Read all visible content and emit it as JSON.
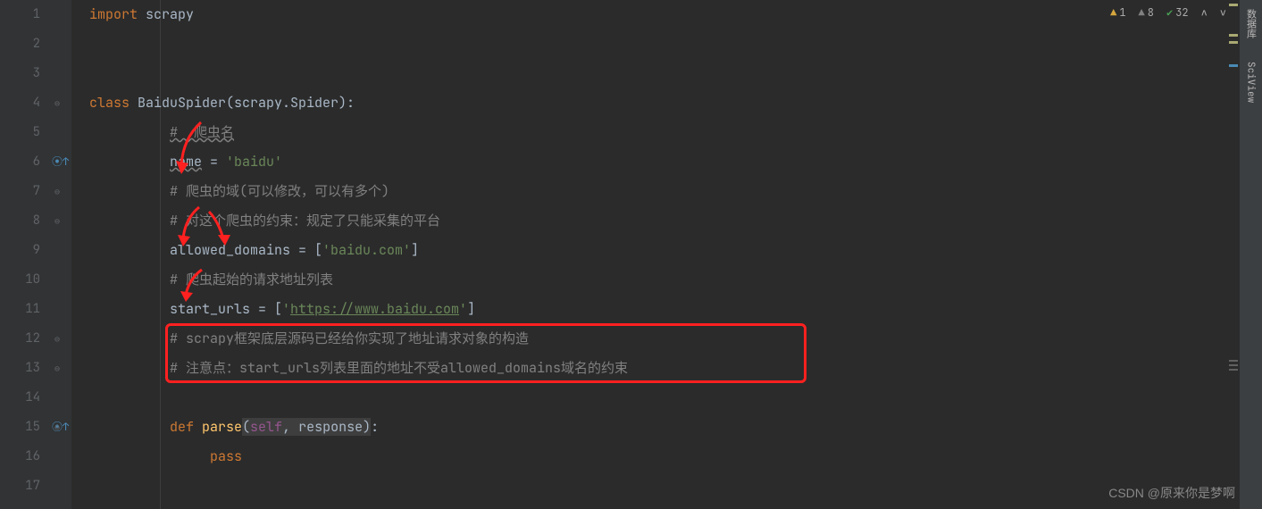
{
  "gutter": {
    "lines": [
      "1",
      "2",
      "3",
      "4",
      "5",
      "6",
      "7",
      "8",
      "9",
      "10",
      "11",
      "12",
      "13",
      "14",
      "15",
      "16",
      "17"
    ]
  },
  "code": {
    "l1_import": "import",
    "l1_scrapy": " scrapy",
    "l4_class": "class",
    "l4_name": " BaiduSpider(scrapy.Spider):",
    "l5_comment": "#  爬虫名",
    "l6_name": "name",
    "l6_eq": " = ",
    "l6_str": "'baidu'",
    "l7_comment": "# 爬虫的域(可以修改，可以有多个)",
    "l8_comment": "# 对这个爬虫的约束：规定了只能采集的平台",
    "l9_var": "allowed_domains = [",
    "l9_str": "'baidu.com'",
    "l9_end": "]",
    "l10_comment": "# 爬虫起始的请求地址列表",
    "l11_var": "start_urls = [",
    "l11_q1": "'",
    "l11_url": "https://www.baidu.com",
    "l11_q2": "'",
    "l11_end": "]",
    "l12_comment": "# scrapy框架底层源码已经给你实现了地址请求对象的构造",
    "l13_comment": "# 注意点：start_urls列表里面的地址不受allowed_domains域名的约束",
    "l15_def": "def",
    "l15_func": " parse",
    "l15_popen": "(",
    "l15_self": "self",
    "l15_comma": ", response",
    "l15_pclose": ")",
    "l15_colon": ":",
    "l16_pass": "pass"
  },
  "status": {
    "warn1": "1",
    "warn2": "8",
    "checks": "32"
  },
  "right_tabs": {
    "database": "数据库",
    "sciview": "SciView"
  },
  "watermark": "CSDN @原来你是梦啊"
}
